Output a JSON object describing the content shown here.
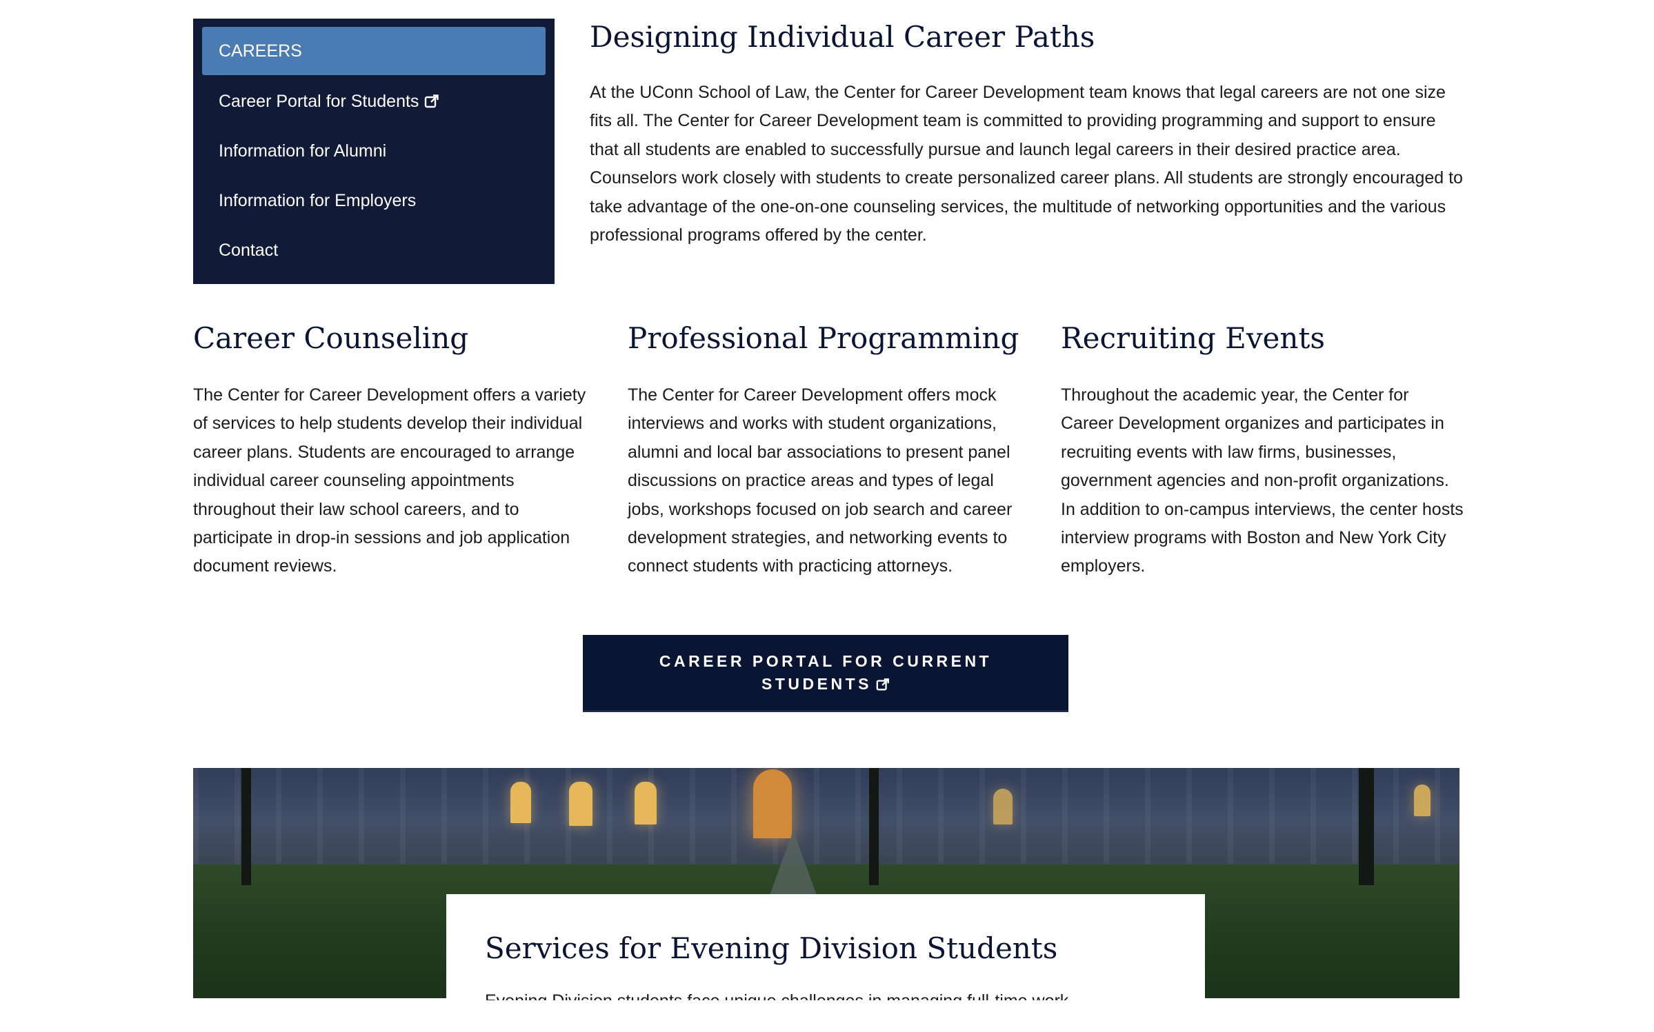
{
  "sidebar": {
    "items": [
      {
        "label": "CAREERS",
        "active": true
      },
      {
        "label": "Career Portal for Students",
        "external": true
      },
      {
        "label": "Information for Alumni"
      },
      {
        "label": "Information for Employers"
      },
      {
        "label": "Contact"
      }
    ]
  },
  "intro": {
    "title": "Designing Individual Career Paths",
    "text": "At the UConn School of Law, the Center for Career Development team knows that legal careers are not one size fits all. The Center for Career Development team is committed to providing programming and support to ensure that all students are enabled to successfully pursue and launch legal careers in their desired practice area. Counselors work closely with students to create personalized career plans. All students are strongly encouraged to take advantage of the one-on-one counseling services, the multitude of networking opportunities and the various professional programs offered by the center."
  },
  "columns": [
    {
      "title": "Career Counseling",
      "text": "The Center for Career Development offers a variety of services to help students develop their individual career plans. Students are encouraged to arrange individual career counseling appointments throughout their law school careers, and to participate in drop-in sessions and job application document reviews."
    },
    {
      "title": "Professional Programming",
      "text": "The Center for Career Development offers mock interviews and works with student organizations, alumni and local bar associations to present panel discussions on practice areas and types of legal jobs, workshops focused on job search and career development strategies, and networking events to connect students with practicing attorneys."
    },
    {
      "title": "Recruiting Events",
      "text": "Throughout the academic year, the Center for Career Development organizes and participates in recruiting events with law firms, businesses, government agencies and non-profit organizations. In addition to on-campus interviews, the center hosts interview programs with Boston and New York City employers."
    }
  ],
  "cta": {
    "line1": "CAREER PORTAL FOR CURRENT",
    "line2": "STUDENTS"
  },
  "evening": {
    "title": "Services for Evening Division Students",
    "text_partial": "Evening Division students face unique challenges in managing full-time work..."
  },
  "colors": {
    "nav_bg": "#111a36",
    "nav_active": "#4a7bb2",
    "cta_bg": "#0a1433",
    "heading": "#0a1433"
  }
}
